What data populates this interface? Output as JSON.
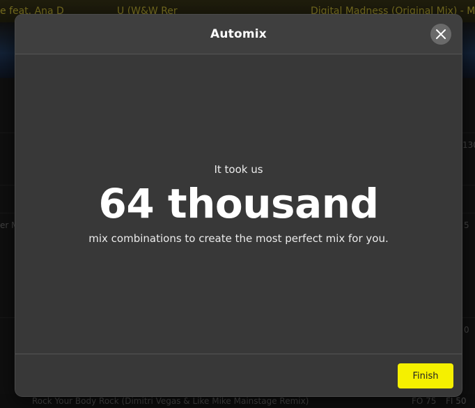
{
  "background": {
    "track_titles": [
      "e feat. Ana D",
      "U (W&W Rer",
      "Digital Madness (Original Mix) - M"
    ],
    "side_labels": [
      "er M",
      "130",
      "5",
      "0"
    ],
    "bottom_track": "Rock Your Body Rock (Dimitri Vegas & Like Mike Mainstage Remix)",
    "bottom_fo": "FO 75",
    "bottom_fi": "FI 50"
  },
  "modal": {
    "title": "Automix",
    "intro": "It took us",
    "highlight": "64 thousand",
    "description": "mix combinations to create the most perfect mix for you.",
    "finish_label": "Finish",
    "accent_color": "#f5f000"
  },
  "icons": {
    "close": "close-icon"
  }
}
